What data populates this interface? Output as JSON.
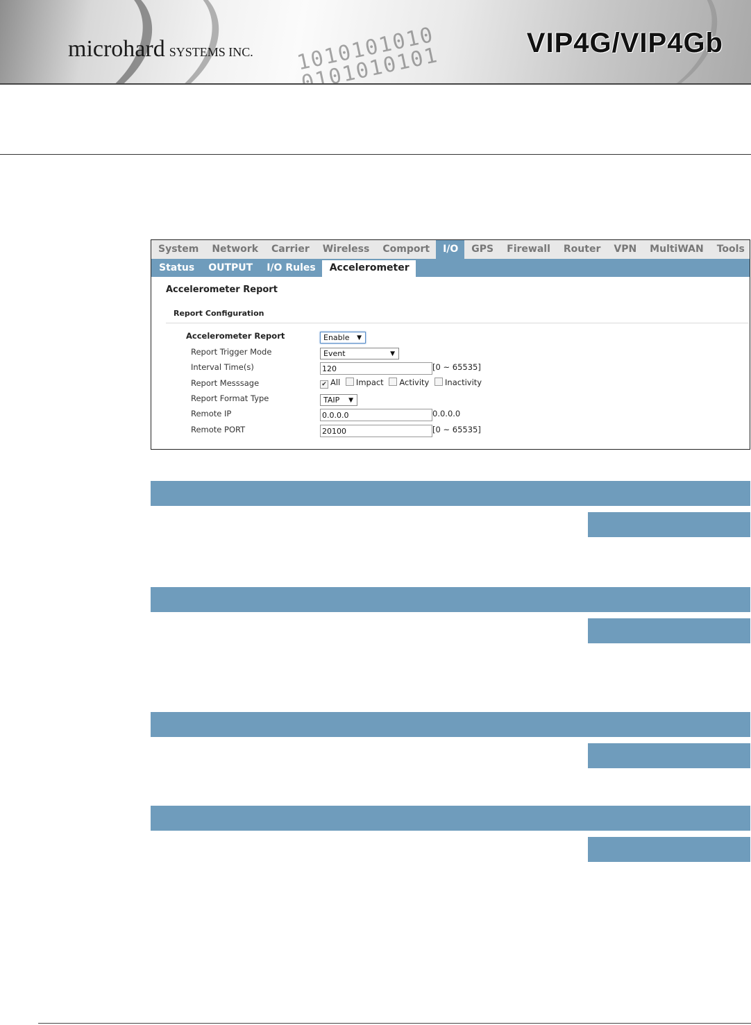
{
  "header": {
    "brand_main": "microhard",
    "brand_sub": "SYSTEMS INC.",
    "product": "VIP4G/VIP4Gb",
    "binary_line1": "1010101010",
    "binary_line2": "0101010101"
  },
  "topnav": [
    "System",
    "Network",
    "Carrier",
    "Wireless",
    "Comport",
    "I/O",
    "GPS",
    "Firewall",
    "Router",
    "VPN",
    "MultiWAN",
    "Tools"
  ],
  "topnav_active": "I/O",
  "subnav": [
    "Status",
    "OUTPUT",
    "I/O Rules",
    "Accelerometer"
  ],
  "subnav_active": "Accelerometer",
  "page_title": "Accelerometer Report",
  "section_title": "Report Configuration",
  "form": {
    "accelerometer_report": {
      "label": "Accelerometer Report",
      "value": "Enable"
    },
    "trigger_mode": {
      "label": "Report Trigger Mode",
      "value": "Event"
    },
    "interval": {
      "label": "Interval Time(s)",
      "value": "120",
      "hint": "[0 ~ 65535]"
    },
    "message": {
      "label": "Report Messsage",
      "options": [
        "All",
        "Impact",
        "Activity",
        "Inactivity"
      ],
      "checked": [
        true,
        false,
        false,
        false
      ]
    },
    "format": {
      "label": "Report Format Type",
      "value": "TAIP"
    },
    "remote_ip": {
      "label": "Remote IP",
      "value": "0.0.0.0",
      "hint": "0.0.0.0"
    },
    "remote_port": {
      "label": "Remote PORT",
      "value": "20100",
      "hint": "[0 ~ 65535]"
    }
  },
  "colors": {
    "nav_blue": "#6f9cbc",
    "nav_gray": "#e8e8e8"
  }
}
